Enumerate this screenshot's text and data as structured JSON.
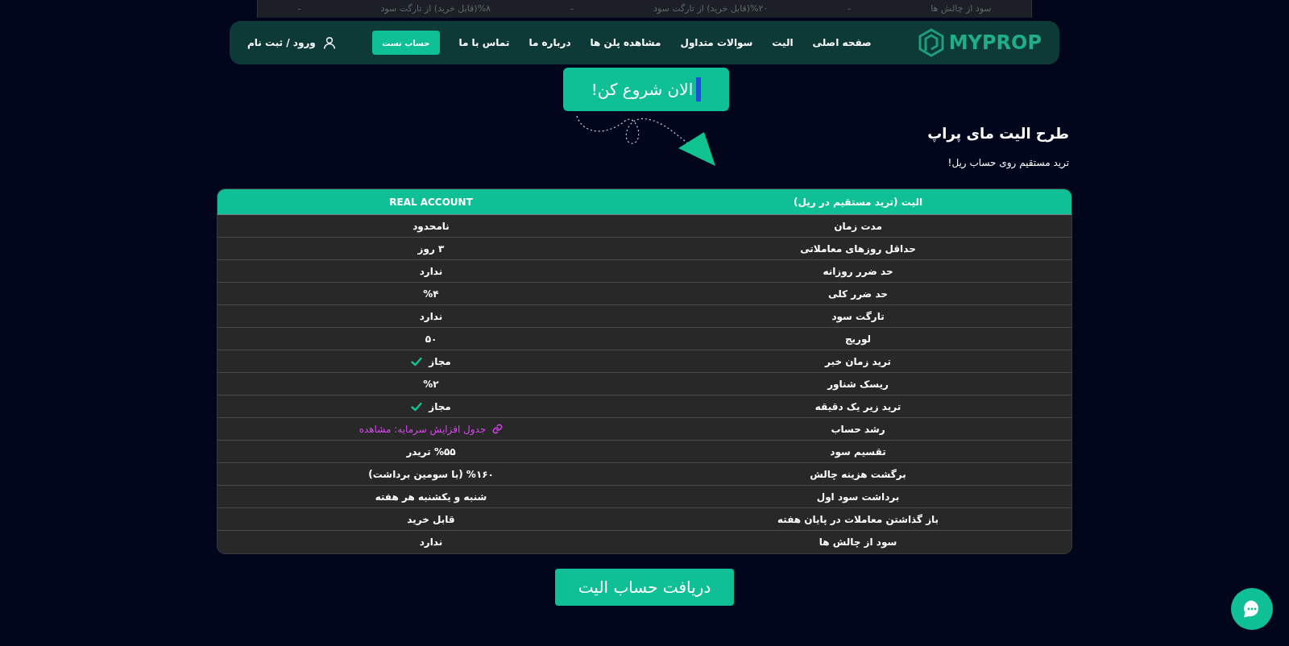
{
  "background_row": {
    "cells": [
      "سود از چالش ها",
      "-",
      "%۲۰(قابل خرید) از تارگت سود",
      "-",
      "%۸(قابل خرید) از تارگت سود",
      "-"
    ]
  },
  "nav": {
    "logo": "MYPROP",
    "links": [
      {
        "label": "صفحه اصلی",
        "kind": "link"
      },
      {
        "label": "الیت",
        "kind": "link"
      },
      {
        "label": "سوالات متداول",
        "kind": "link"
      },
      {
        "label": "مشاهده پلن ها",
        "kind": "link"
      },
      {
        "label": "درباره ما",
        "kind": "link"
      },
      {
        "label": "تماس با ما",
        "kind": "link"
      },
      {
        "label": "حساب تست",
        "kind": "button"
      }
    ],
    "account": "ورود / ثبت نام"
  },
  "hero_button": "الان شروع کن!",
  "section": {
    "title": "طرح الیت مای پراپ",
    "subtitle": "ترید مستقیم روی حساب ریل!"
  },
  "table": {
    "columns": [
      "الیت (ترید مستقیم در ریل)",
      "REAL ACCOUNT"
    ],
    "rows": [
      {
        "label": "مدت زمان",
        "value": "نامحدود",
        "kind": "text"
      },
      {
        "label": "حداقل روزهای معاملاتی",
        "value": "۳ روز",
        "kind": "text"
      },
      {
        "label": "حد ضرر روزانه",
        "value": "ندارد",
        "kind": "text"
      },
      {
        "label": "حد ضرر کلی",
        "value": "%۴",
        "kind": "text"
      },
      {
        "label": "تارگت سود",
        "value": "ندارد",
        "kind": "text"
      },
      {
        "label": "لوریج",
        "value": "۵۰",
        "kind": "text"
      },
      {
        "label": "ترید زمان خبر",
        "value": "مجاز",
        "kind": "check"
      },
      {
        "label": "ریسک شناور",
        "value": "%۲",
        "kind": "text"
      },
      {
        "label": "ترید زیر یک دقیقه",
        "value": "مجاز",
        "kind": "check"
      },
      {
        "label": "رشد حساب",
        "value": "جدول افزایش سرمایه: مشاهده",
        "kind": "link"
      },
      {
        "label": "تقسیم سود",
        "value": "%۵۵ تریدر",
        "kind": "text"
      },
      {
        "label": "برگشت هزینه چالش",
        "value": "%۱۶۰ (با سومین برداشت)",
        "kind": "text"
      },
      {
        "label": "برداشت سود اول",
        "value": "شنبه و یکشنبه هر هفته",
        "kind": "text"
      },
      {
        "label": "باز گذاشتن معاملات در پایان هفته",
        "value": "قابل خرید",
        "kind": "text"
      },
      {
        "label": "سود از چالش ها",
        "value": "ندارد",
        "kind": "text"
      }
    ]
  },
  "cta_button": "دریافت حساب الیت"
}
